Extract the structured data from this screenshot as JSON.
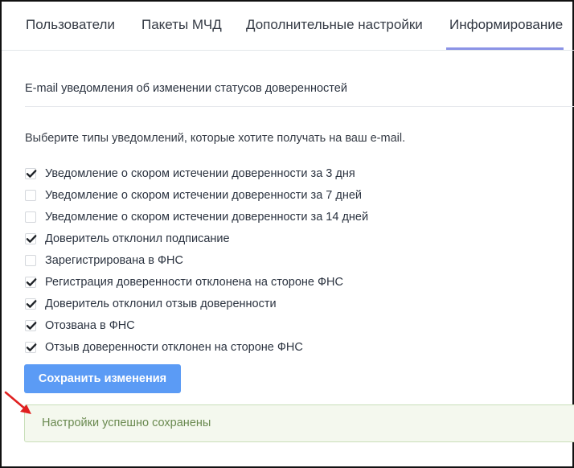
{
  "tabs": [
    {
      "label": "Пользователи"
    },
    {
      "label": "Пакеты МЧД"
    },
    {
      "label": "Дополнительные настройки"
    },
    {
      "label": "Информирование",
      "active": true
    }
  ],
  "section": {
    "title": "E-mail уведомления об изменении статусов доверенностей",
    "hint": "Выберите типы уведомлений, которые хотите получать на ваш e-mail."
  },
  "notifications": [
    {
      "label": "Уведомление о скором истечении доверенности за 3 дня",
      "checked": true
    },
    {
      "label": "Уведомление о скором истечении доверенности за 7 дней",
      "checked": false
    },
    {
      "label": "Уведомление о скором истечении доверенности за 14 дней",
      "checked": false
    },
    {
      "label": "Доверитель отклонил подписание",
      "checked": true
    },
    {
      "label": "Зарегистрирована в ФНС",
      "checked": false
    },
    {
      "label": "Регистрация доверенности отклонена на стороне ФНС",
      "checked": true
    },
    {
      "label": "Доверитель отклонил отзыв доверенности",
      "checked": true
    },
    {
      "label": "Отозвана в ФНС",
      "checked": true
    },
    {
      "label": "Отзыв доверенности отклонен на стороне ФНС",
      "checked": true
    }
  ],
  "actions": {
    "save_label": "Сохранить изменения"
  },
  "alert": {
    "message": "Настройки успешно сохранены"
  },
  "colors": {
    "accent": "#5b9bf5",
    "tab_underline": "#8b93e6",
    "success_bg": "#f4f8ee",
    "success_text": "#6a8a50",
    "annotation_arrow": "#e02020"
  },
  "icons": {
    "checkbox_checked": "check-icon",
    "annotation": "red-arrow-icon"
  }
}
